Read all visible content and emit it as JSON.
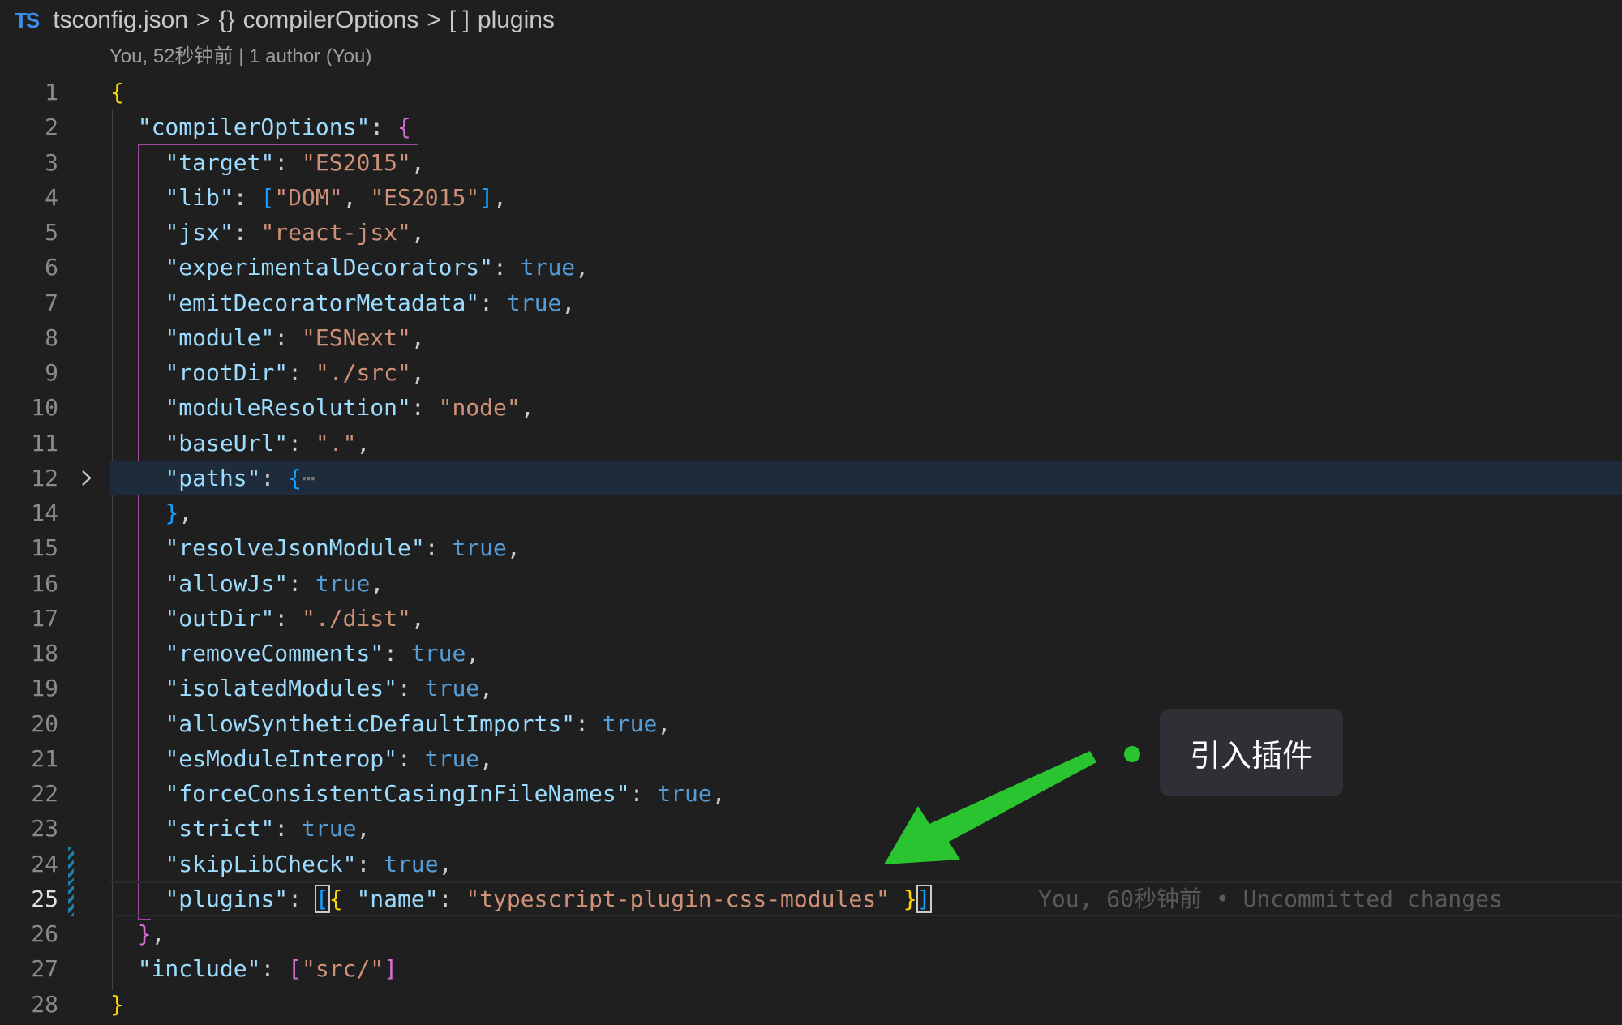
{
  "breadcrumb": {
    "icon_label": "TS",
    "file": "tsconfig.json",
    "sep": ">",
    "item1_symbol": "{}",
    "item1": "compilerOptions",
    "item2_symbol": "[ ]",
    "item2": "plugins"
  },
  "blame_header": "You, 52秒钟前 | 1 author (You)",
  "editor": {
    "line_numbers": [
      "1",
      "2",
      "3",
      "4",
      "5",
      "6",
      "7",
      "8",
      "9",
      "10",
      "11",
      "12",
      "14",
      "15",
      "16",
      "17",
      "18",
      "19",
      "20",
      "21",
      "22",
      "23",
      "24",
      "25",
      "26",
      "27",
      "28"
    ],
    "lines": {
      "l1_b": "{",
      "l2_k": "\"compilerOptions\"",
      "l2_p": ": ",
      "l2_b": "{",
      "l3_k": "\"target\"",
      "l3_p": ": ",
      "l3_v": "\"ES2015\"",
      "l3_c": ",",
      "l4_k": "\"lib\"",
      "l4_p": ": ",
      "l4_b1": "[",
      "l4_v1": "\"DOM\"",
      "l4_c1": ", ",
      "l4_v2": "\"ES2015\"",
      "l4_b2": "]",
      "l4_c": ",",
      "l5_k": "\"jsx\"",
      "l5_p": ": ",
      "l5_v": "\"react-jsx\"",
      "l5_c": ",",
      "l6_k": "\"experimentalDecorators\"",
      "l6_p": ": ",
      "l6_v": "true",
      "l6_c": ",",
      "l7_k": "\"emitDecoratorMetadata\"",
      "l7_p": ": ",
      "l7_v": "true",
      "l7_c": ",",
      "l8_k": "\"module\"",
      "l8_p": ": ",
      "l8_v": "\"ESNext\"",
      "l8_c": ",",
      "l9_k": "\"rootDir\"",
      "l9_p": ": ",
      "l9_v": "\"./src\"",
      "l9_c": ",",
      "l10_k": "\"moduleResolution\"",
      "l10_p": ": ",
      "l10_v": "\"node\"",
      "l10_c": ",",
      "l11_k": "\"baseUrl\"",
      "l11_p": ": ",
      "l11_v": "\".\"",
      "l11_c": ",",
      "l12_k": "\"paths\"",
      "l12_p": ": ",
      "l12_b": "{",
      "l12_f": "⋯",
      "l14_b": "}",
      "l14_c": ",",
      "l15_k": "\"resolveJsonModule\"",
      "l15_p": ": ",
      "l15_v": "true",
      "l15_c": ",",
      "l16_k": "\"allowJs\"",
      "l16_p": ": ",
      "l16_v": "true",
      "l16_c": ",",
      "l17_k": "\"outDir\"",
      "l17_p": ": ",
      "l17_v": "\"./dist\"",
      "l17_c": ",",
      "l18_k": "\"removeComments\"",
      "l18_p": ": ",
      "l18_v": "true",
      "l18_c": ",",
      "l19_k": "\"isolatedModules\"",
      "l19_p": ": ",
      "l19_v": "true",
      "l19_c": ",",
      "l20_k": "\"allowSyntheticDefaultImports\"",
      "l20_p": ": ",
      "l20_v": "true",
      "l20_c": ",",
      "l21_k": "\"esModuleInterop\"",
      "l21_p": ": ",
      "l21_v": "true",
      "l21_c": ",",
      "l22_k": "\"forceConsistentCasingInFileNames\"",
      "l22_p": ": ",
      "l22_v": "true",
      "l22_c": ",",
      "l23_k": "\"strict\"",
      "l23_p": ": ",
      "l23_v": "true",
      "l23_c": ",",
      "l24_k": "\"skipLibCheck\"",
      "l24_p": ": ",
      "l24_v": "true",
      "l24_c": ",",
      "l25_k": "\"plugins\"",
      "l25_p": ": ",
      "l25_b1": "[",
      "l25_b2": "{",
      "l25_sp": " ",
      "l25_k2": "\"name\"",
      "l25_p2": ": ",
      "l25_v": "\"typescript-plugin-css-modules\"",
      "l25_sp2": " ",
      "l25_b3": "}",
      "l25_b4": "]",
      "l26_b": "}",
      "l26_c": ",",
      "l27_k": "\"include\"",
      "l27_p": ": ",
      "l27_b1": "[",
      "l27_v": "\"src/\"",
      "l27_b2": "]",
      "l28_b": "}"
    },
    "inline_blame": "You, 60秒钟前 • Uncommitted changes"
  },
  "annotation": {
    "text": "引入插件",
    "color": "#2bc431"
  },
  "icons": {
    "ts_file": "typescript-file-icon",
    "fold": "chevron-right-icon"
  },
  "colors": {
    "background": "#1f1f1f",
    "key": "#9cdcfe",
    "string": "#ce9178",
    "boolean": "#569cd6",
    "bracket_gold": "#ffd700",
    "bracket_purple": "#da70d6",
    "bracket_blue": "#179fff"
  }
}
